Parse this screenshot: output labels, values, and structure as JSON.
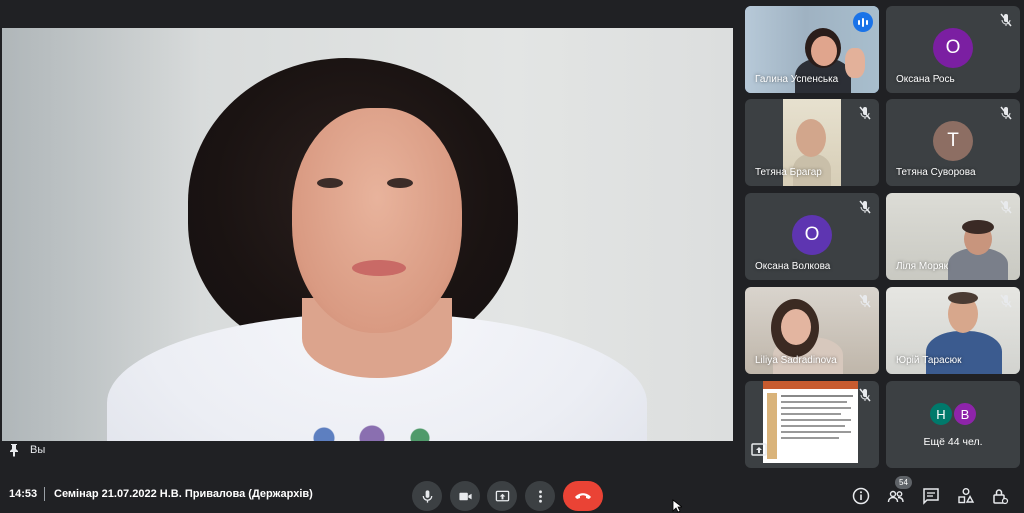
{
  "self_label": "Вы",
  "participants": [
    {
      "name": "Галина Успенська",
      "speaking": true
    },
    {
      "name": "Оксана Рось",
      "initial": "О",
      "color": "#7b1fa2"
    },
    {
      "name": "Тетяна Брагар"
    },
    {
      "name": "Тетяна Суворова",
      "initial": "Т",
      "color": "#8d6e63"
    },
    {
      "name": "Оксана Волкова",
      "initial": "О",
      "color": "#5e35b1"
    },
    {
      "name": "Ліля Моряк"
    },
    {
      "name": "Liliya Sadradinova"
    },
    {
      "name": "Юрій Тарасюк"
    }
  ],
  "others": {
    "initials": [
      "Н",
      "В"
    ],
    "colors": [
      "#00796b",
      "#8e24aa"
    ],
    "label": "Ещё 44 чел."
  },
  "bottom_bar": {
    "time": "14:53",
    "title": "Семінар 21.07.2022 Н.В. Привалова (Держархів)",
    "people_count": "54"
  },
  "icons": {
    "mic": "mic-icon",
    "camera": "camera-icon",
    "present": "present-screen-icon",
    "more": "more-options-icon",
    "end_call": "end-call-icon",
    "info": "info-icon",
    "people": "people-icon",
    "chat": "chat-icon",
    "activities": "activities-icon",
    "host_controls": "host-controls-icon"
  },
  "colors": {
    "background": "#202124",
    "tile": "#3c4043",
    "accent": "#1a73e8",
    "end_call": "#ea4335"
  }
}
